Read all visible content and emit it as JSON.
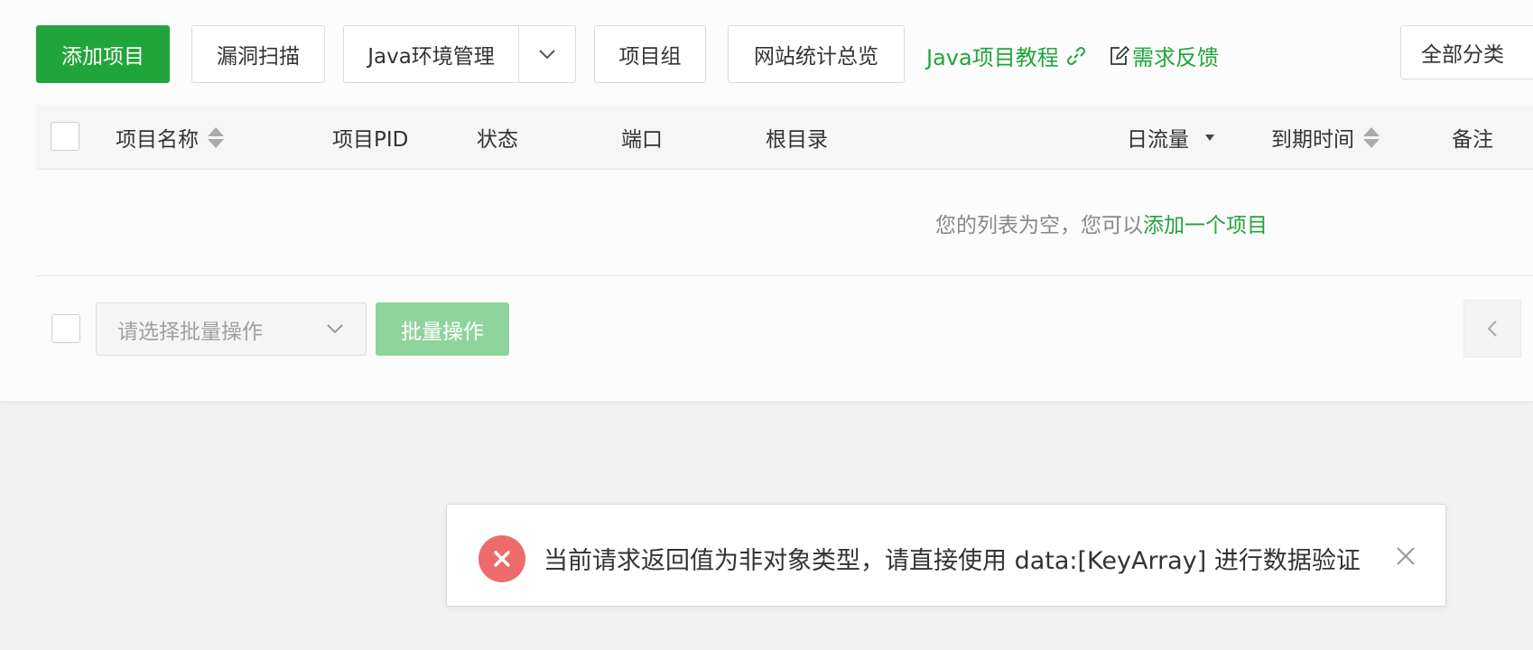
{
  "toolbar": {
    "add_project": "添加项目",
    "vuln_scan": "漏洞扫描",
    "java_env": "Java环境管理",
    "project_group": "项目组",
    "site_stats": "网站统计总览",
    "java_tutorial": "Java项目教程",
    "feedback": "需求反馈",
    "category": "全部分类"
  },
  "table": {
    "columns": [
      "项目名称",
      "项目PID",
      "状态",
      "端口",
      "根目录",
      "日流量",
      "到期时间",
      "备注"
    ],
    "empty_text": "您的列表为空，您可以",
    "empty_link": "添加一个项目"
  },
  "footer": {
    "batch_placeholder": "请选择批量操作",
    "batch_button": "批量操作"
  },
  "toast": {
    "message": "当前请求返回值为非对象类型，请直接使用 data:[KeyArray] 进行数据验证",
    "type": "error"
  },
  "colors": {
    "brand": "#20a53a",
    "error": "#ee6b6b"
  }
}
